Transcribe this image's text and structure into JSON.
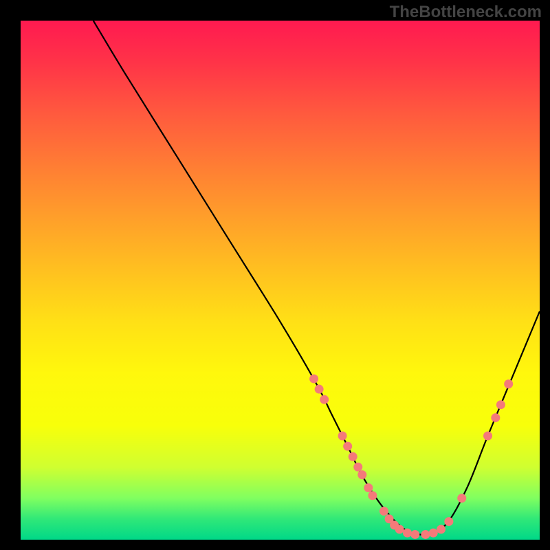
{
  "watermark": "TheBottleneck.com",
  "chart_data": {
    "type": "line",
    "title": "",
    "xlabel": "",
    "ylabel": "",
    "xlim": [
      0,
      100
    ],
    "ylim": [
      0,
      100
    ],
    "series": [
      {
        "name": "curve",
        "x": [
          14,
          20,
          30,
          40,
          50,
          57,
          60,
          63,
          66,
          70,
          74,
          78,
          82,
          86,
          90,
          95,
          100
        ],
        "y": [
          100,
          90,
          74,
          58,
          42,
          30,
          24,
          18,
          12,
          6,
          2,
          1,
          3,
          10,
          20,
          32,
          44
        ]
      }
    ],
    "markers": [
      {
        "x": 56.5,
        "y": 31
      },
      {
        "x": 57.5,
        "y": 29
      },
      {
        "x": 58.5,
        "y": 27
      },
      {
        "x": 62,
        "y": 20
      },
      {
        "x": 63,
        "y": 18
      },
      {
        "x": 64,
        "y": 16
      },
      {
        "x": 65,
        "y": 14
      },
      {
        "x": 65.8,
        "y": 12.5
      },
      {
        "x": 67,
        "y": 10
      },
      {
        "x": 67.8,
        "y": 8.5
      },
      {
        "x": 70,
        "y": 5.5
      },
      {
        "x": 71,
        "y": 4
      },
      {
        "x": 72,
        "y": 2.8
      },
      {
        "x": 73,
        "y": 2
      },
      {
        "x": 74.5,
        "y": 1.3
      },
      {
        "x": 76,
        "y": 1
      },
      {
        "x": 78,
        "y": 1
      },
      {
        "x": 79.5,
        "y": 1.3
      },
      {
        "x": 81,
        "y": 2
      },
      {
        "x": 82.5,
        "y": 3.5
      },
      {
        "x": 85,
        "y": 8
      },
      {
        "x": 90,
        "y": 20
      },
      {
        "x": 91.5,
        "y": 23.5
      },
      {
        "x": 92.5,
        "y": 26
      },
      {
        "x": 94,
        "y": 30
      }
    ],
    "colors": {
      "curve": "#000000",
      "marker_fill": "#f47a7a"
    }
  }
}
